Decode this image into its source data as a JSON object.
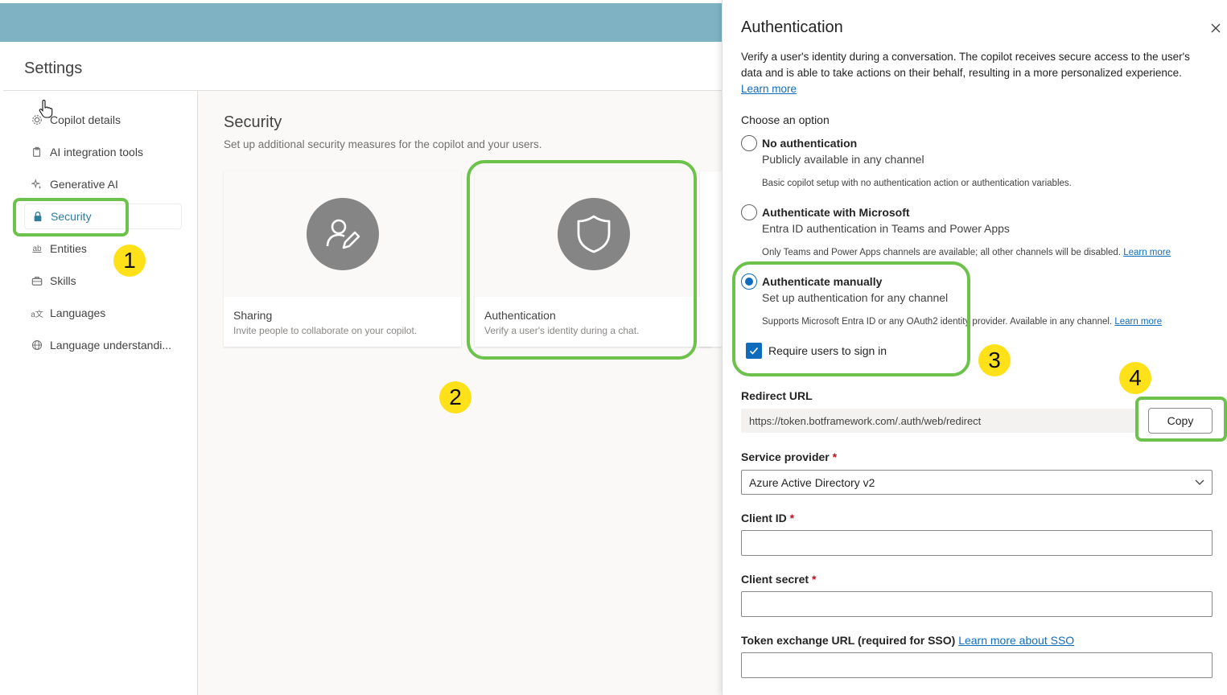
{
  "settings": {
    "title": "Settings"
  },
  "nav": {
    "items": [
      {
        "label": "Copilot details",
        "icon": "gear-icon"
      },
      {
        "label": "AI integration tools",
        "icon": "clipboard-icon"
      },
      {
        "label": "Generative AI",
        "icon": "sparkle-icon"
      },
      {
        "label": "Security",
        "icon": "lock-icon",
        "active": true
      },
      {
        "label": "Entities",
        "icon": "ab-icon"
      },
      {
        "label": "Skills",
        "icon": "briefcase-icon"
      },
      {
        "label": "Languages",
        "icon": "translate-icon"
      },
      {
        "label": "Language understandi...",
        "icon": "globe-icon"
      }
    ]
  },
  "main": {
    "title": "Security",
    "subtitle": "Set up additional security measures for the copilot and your users.",
    "cards": [
      {
        "title": "Sharing",
        "description": "Invite people to collaborate on your copilot.",
        "icon": "person-edit-icon"
      },
      {
        "title": "Authentication",
        "description": "Verify a user's identity during a chat.",
        "icon": "shield-icon"
      }
    ]
  },
  "badges": [
    "1",
    "2",
    "3",
    "4"
  ],
  "panel": {
    "title": "Authentication",
    "description": "Verify a user's identity during a conversation. The copilot receives secure access to the user's data and is able to take actions on their behalf, resulting in a more personalized experience.",
    "learn_more": "Learn more",
    "choose_label": "Choose an option",
    "options": [
      {
        "title": "No authentication",
        "subtitle": "Publicly available in any channel",
        "note": "Basic copilot setup with no authentication action or authentication variables.",
        "checked": false
      },
      {
        "title": "Authenticate with Microsoft",
        "subtitle": "Entra ID authentication in Teams and Power Apps",
        "note": "Only Teams and Power Apps channels are available; all other channels will be disabled.",
        "link": "Learn more",
        "checked": false
      },
      {
        "title": "Authenticate manually",
        "subtitle": "Set up authentication for any channel",
        "note": "Supports Microsoft Entra ID or any OAuth2 identity provider. Available in any channel.",
        "link": "Learn more",
        "checked": true
      }
    ],
    "require_signin": {
      "label": "Require users to sign in",
      "checked": true
    },
    "redirect": {
      "label": "Redirect URL",
      "value": "https://token.botframework.com/.auth/web/redirect",
      "copy_label": "Copy"
    },
    "service_provider": {
      "label": "Service provider",
      "value": "Azure Active Directory v2"
    },
    "client_id": {
      "label": "Client ID",
      "value": ""
    },
    "client_secret": {
      "label": "Client secret",
      "value": ""
    },
    "token_exchange": {
      "label": "Token exchange URL (required for SSO)",
      "link": "Learn more about SSO",
      "value": ""
    },
    "required_mark": "*"
  },
  "colors": {
    "topbar": "#7fb3c3",
    "accent": "#0f6cbd",
    "highlight": "#6cc24a",
    "badge": "#ffe11a",
    "active_nav": "#2e7d9a"
  }
}
